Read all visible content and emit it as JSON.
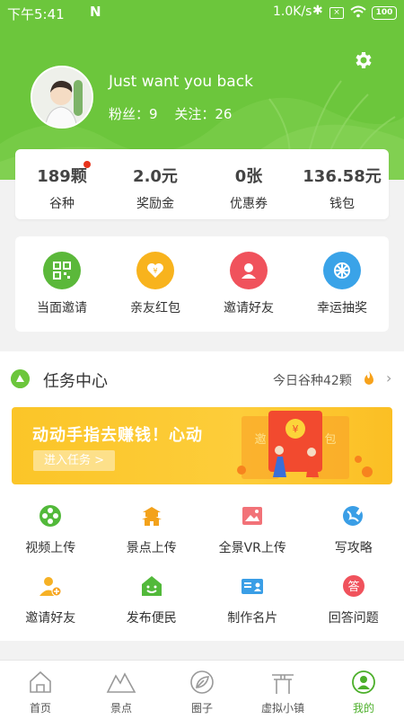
{
  "status_bar": {
    "time": "下午5:41",
    "net_speed": "1.0K/s",
    "battery": "100"
  },
  "profile": {
    "username": "Just want you back",
    "fans_label": "粉丝：",
    "fans": "9",
    "follow_label": "关注：",
    "follow": "26"
  },
  "stats": [
    {
      "value": "189颗",
      "label": "谷种"
    },
    {
      "value": "2.0元",
      "label": "奖励金"
    },
    {
      "value": "0张",
      "label": "优惠券"
    },
    {
      "value": "136.58元",
      "label": "钱包"
    }
  ],
  "quick_actions": [
    {
      "label": "当面邀请",
      "icon": "qr-code-icon",
      "color": "#5bb83a"
    },
    {
      "label": "亲友红包",
      "icon": "red-envelope-icon",
      "color": "#f8b31d"
    },
    {
      "label": "邀请好友",
      "icon": "person-icon",
      "color": "#f0525c"
    },
    {
      "label": "幸运抽奖",
      "icon": "wheel-icon",
      "color": "#3aa3e8"
    }
  ],
  "task_center": {
    "title": "任务中心",
    "today": "今日谷种42颗",
    "banner_title": "动动手指去赚钱！心动",
    "banner_button": "进入任务 >",
    "banner_card_left": "邀",
    "banner_card_right": "包",
    "items": [
      {
        "label": "视频上传",
        "icon": "video-reel-icon"
      },
      {
        "label": "景点上传",
        "icon": "pagoda-icon"
      },
      {
        "label": "全景VR上传",
        "icon": "panorama-image-icon"
      },
      {
        "label": "写攻略",
        "icon": "globe-pen-icon"
      },
      {
        "label": "邀请好友",
        "icon": "add-person-icon"
      },
      {
        "label": "发布便民",
        "icon": "smile-house-icon"
      },
      {
        "label": "制作名片",
        "icon": "business-card-icon"
      },
      {
        "label": "回答问题",
        "icon": "answer-icon",
        "glyph": "答"
      }
    ]
  },
  "nav": [
    {
      "label": "首页",
      "icon": "home-icon"
    },
    {
      "label": "景点",
      "icon": "mountain-icon"
    },
    {
      "label": "圈子",
      "icon": "leaf-icon"
    },
    {
      "label": "虚拟小镇",
      "icon": "gate-icon"
    },
    {
      "label": "我的",
      "icon": "profile-icon",
      "active": true
    }
  ],
  "colors": {
    "brand": "#6cc63c",
    "banner": "#fbc528",
    "active_nav": "#4caf2a",
    "alert_dot": "#e8331c"
  }
}
